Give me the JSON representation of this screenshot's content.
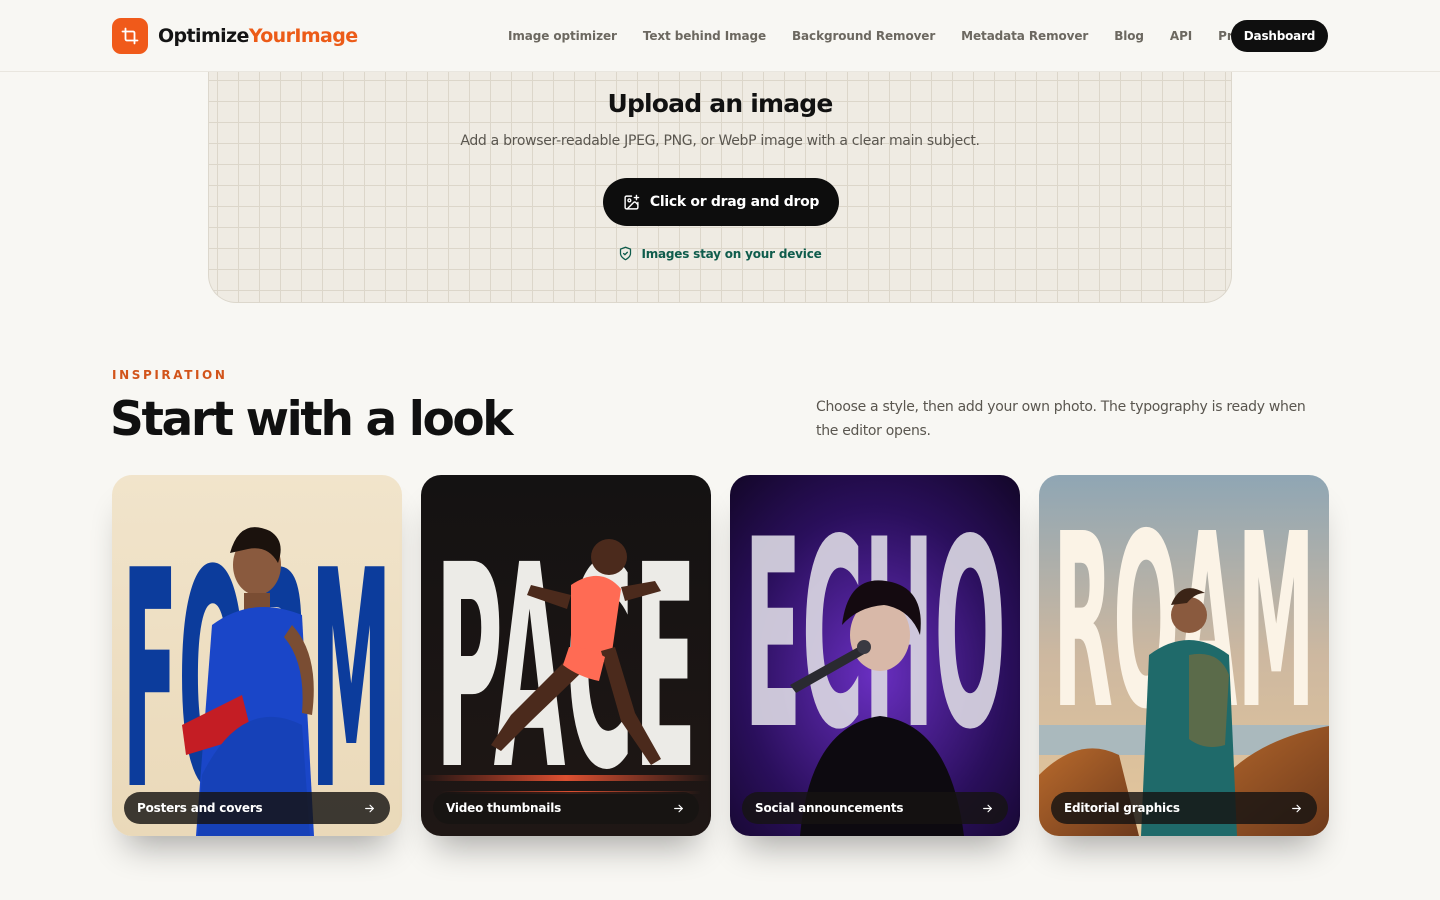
{
  "brand": {
    "name_part1": "Optimize",
    "name_part2": "YourImage",
    "accent": "#f05a1a"
  },
  "nav": {
    "items": [
      {
        "label": "Image optimizer"
      },
      {
        "label": "Text behind Image"
      },
      {
        "label": "Background Remover"
      },
      {
        "label": "Metadata Remover"
      },
      {
        "label": "Blog"
      },
      {
        "label": "API"
      },
      {
        "label": "Pricing"
      }
    ],
    "cta_label": "Dashboard"
  },
  "upload": {
    "title": "Upload an image",
    "subtitle": "Add a browser-readable JPEG, PNG, or WebP image with a clear main subject.",
    "button_label": "Click or drag and drop",
    "button_icon": "image-plus-icon",
    "privacy_note": "Images stay on your device",
    "privacy_icon": "shield-check-icon"
  },
  "inspiration": {
    "eyebrow": "INSPIRATION",
    "title": "Start with a look",
    "description": "Choose a style, then add your own photo. The typography is ready when the editor opens.",
    "cards": [
      {
        "word": "FORM",
        "label": "Posters and covers",
        "icon": "arrow-right-icon"
      },
      {
        "word": "PACE",
        "label": "Video thumbnails",
        "icon": "arrow-right-icon"
      },
      {
        "word": "ECHO",
        "label": "Social announcements",
        "icon": "arrow-right-icon"
      },
      {
        "word": "ROAM",
        "label": "Editorial graphics",
        "icon": "arrow-right-icon"
      }
    ]
  }
}
